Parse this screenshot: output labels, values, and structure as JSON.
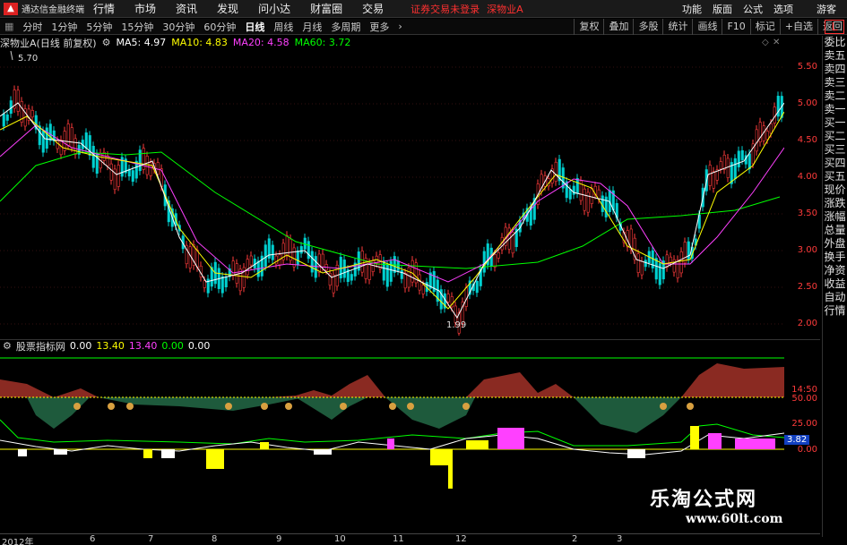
{
  "window": {
    "app_name": "通达信金融终端",
    "menu": [
      "行情",
      "市场",
      "资讯",
      "发现",
      "问小达",
      "财富圈",
      "交易"
    ],
    "security_warning": "证券交易未登录",
    "security_name": "深物业A",
    "right_menu": [
      "功能",
      "版面",
      "公式",
      "选项"
    ],
    "guest": "游客"
  },
  "toolbar": {
    "periods": [
      "分时",
      "1分钟",
      "5分钟",
      "15分钟",
      "30分钟",
      "60分钟",
      "日线",
      "周线",
      "月线",
      "多周期",
      "更多"
    ],
    "active_period": "日线",
    "right_buttons": [
      "复权",
      "叠加",
      "多股",
      "统计",
      "画线",
      "F10",
      "标记",
      "+自选",
      "返回"
    ],
    "indicator_box": "L"
  },
  "info": {
    "stock": "深物业A(日线 前复权)",
    "ma5": "MA5: 4.97",
    "ma10": "MA10: 4.83",
    "ma20": "MA20: 4.58",
    "ma60": "MA60: 3.72"
  },
  "price_axis": [
    "5.50",
    "5.00",
    "4.50",
    "4.00",
    "3.50",
    "3.00",
    "2.50",
    "2.00"
  ],
  "annotations": {
    "high": "5.70",
    "low": "1.99"
  },
  "indicator": {
    "name": "股票指标网",
    "v1": "0.00",
    "v2": "13.40",
    "v3": "13.40",
    "v4": "0.00",
    "v5": "0.00",
    "axis": [
      "14:50",
      "14:50",
      "50.00",
      "14:50",
      "25.00",
      "14:50",
      "3.82",
      "0.00",
      "14:50"
    ]
  },
  "side_panel": [
    "委比",
    "卖五",
    "卖四",
    "卖三",
    "卖二",
    "卖一",
    "买一",
    "买二",
    "买三",
    "买四",
    "买五",
    "现价",
    "涨跌",
    "涨幅",
    "总量",
    "外盘",
    "换手",
    "净资",
    "收益",
    "自动",
    "行情"
  ],
  "x_axis": [
    "2012年",
    "6",
    "7",
    "8",
    "9",
    "10",
    "11",
    "12",
    "2",
    "3"
  ],
  "watermark": {
    "line1": "乐淘公式网",
    "line2": "www.60lt.com"
  },
  "colors": {
    "ma5": "#ffffff",
    "ma10": "#ffff00",
    "ma20": "#ff40ff",
    "ma60": "#00ff00",
    "up": "#ff3b3b",
    "down": "#00d0d0"
  }
}
